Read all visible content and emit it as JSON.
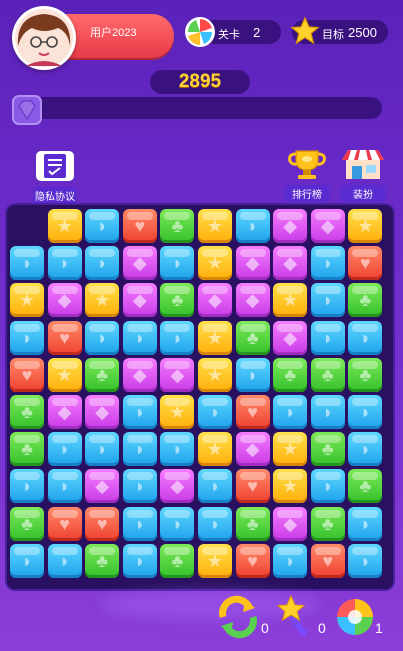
{
  "header": {
    "username": "用户2023",
    "level_label": "关卡",
    "level_value": "2",
    "target_label": "目标",
    "target_value": "2500",
    "score": "2895"
  },
  "progress": {
    "fraction": 0.0
  },
  "buttons": {
    "privacy": "隐私协议",
    "leaderboard": "排行榜",
    "dressup": "装扮"
  },
  "powerups": {
    "refresh_count": "0",
    "wand_count": "0",
    "colorball_count": "1"
  },
  "board": {
    "cols": 10,
    "rows": 10,
    "empty_top_cells": [
      0,
      2
    ],
    "tiles": [
      [
        "empty",
        "yellow",
        "blue",
        "red",
        "green",
        "yellow",
        "blue",
        "pink",
        "pink",
        "yellow"
      ],
      [
        "blue",
        "blue",
        "blue",
        "pink",
        "blue",
        "yellow",
        "pink",
        "pink",
        "blue",
        "red"
      ],
      [
        "yellow",
        "pink",
        "yellow",
        "pink",
        "green",
        "pink",
        "pink",
        "yellow",
        "blue",
        "green"
      ],
      [
        "blue",
        "red",
        "blue",
        "blue",
        "blue",
        "yellow",
        "green",
        "pink",
        "blue",
        "blue"
      ],
      [
        "red",
        "yellow",
        "green",
        "pink",
        "pink",
        "yellow",
        "blue",
        "green",
        "green",
        "green"
      ],
      [
        "green",
        "pink",
        "pink",
        "blue",
        "yellow",
        "blue",
        "red",
        "blue",
        "blue",
        "blue"
      ],
      [
        "green",
        "blue",
        "blue",
        "blue",
        "blue",
        "yellow",
        "pink",
        "yellow",
        "green",
        "blue"
      ],
      [
        "blue",
        "blue",
        "pink",
        "blue",
        "pink",
        "blue",
        "red",
        "yellow",
        "blue",
        "green"
      ],
      [
        "green",
        "red",
        "red",
        "blue",
        "blue",
        "blue",
        "green",
        "pink",
        "green",
        "blue"
      ],
      [
        "blue",
        "blue",
        "green",
        "blue",
        "green",
        "yellow",
        "red",
        "blue",
        "red",
        "blue"
      ]
    ]
  }
}
